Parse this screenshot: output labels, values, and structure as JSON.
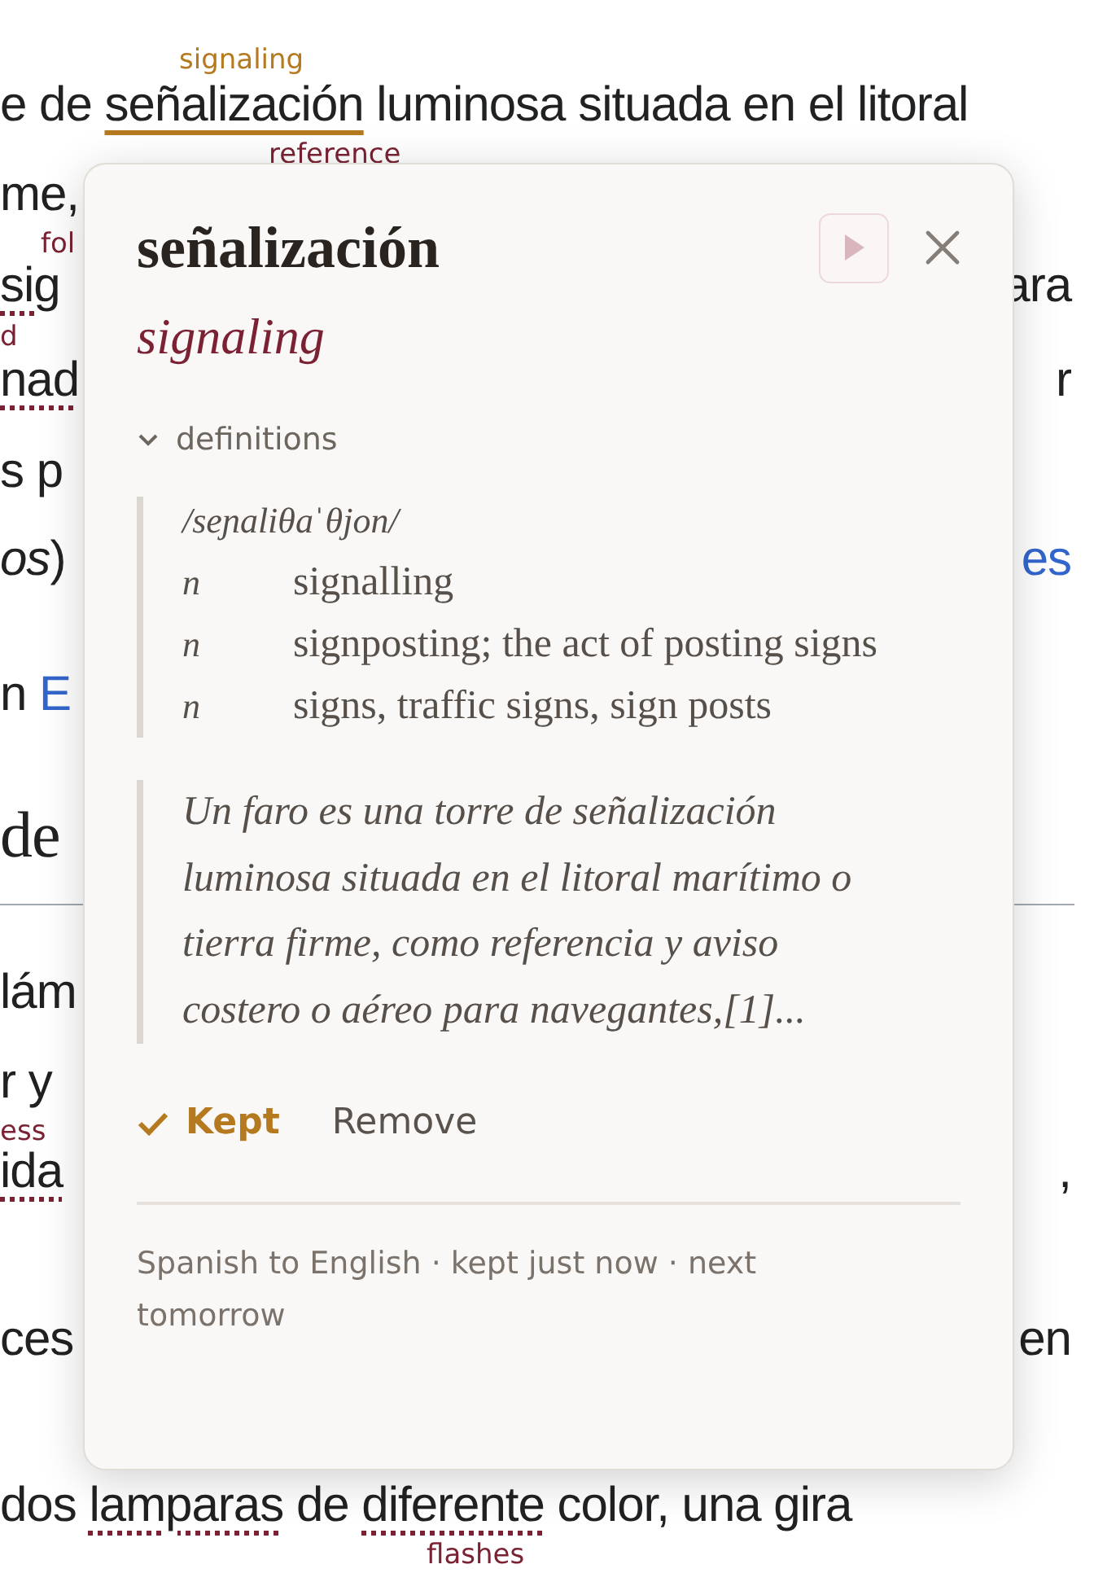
{
  "article": {
    "rows": [
      {
        "kind": "text",
        "left": [
          {
            "text": "e de ",
            "kind": "plain"
          },
          {
            "text": "señalización",
            "kind": "current"
          },
          {
            "text": " luminosa situada en el litoral",
            "kind": "plain"
          }
        ],
        "right": [],
        "glosses": [
          {
            "text": "signaling",
            "color": "#b5791f"
          },
          {
            "text": "reference",
            "color": "#7a2233"
          }
        ]
      },
      {
        "kind": "text",
        "left": [
          {
            "text": "me,",
            "kind": "plain"
          }
        ],
        "right": [],
        "glosses": [
          {
            "text": "fol",
            "color": "#7a2233"
          }
        ]
      },
      {
        "kind": "text",
        "left": [
          {
            "text": "sig",
            "kind": "pending"
          }
        ],
        "right": [
          {
            "text": "ara",
            "kind": "plain"
          }
        ],
        "glosses": [
          {
            "text": "d",
            "color": "#7a2233"
          }
        ]
      },
      {
        "kind": "text",
        "left": [
          {
            "text": "nad",
            "kind": "pending"
          }
        ],
        "right": [
          {
            "text": "r",
            "kind": "plain"
          }
        ],
        "glosses": []
      },
      {
        "kind": "text",
        "left": [
          {
            "text": "s p",
            "kind": "plain"
          }
        ],
        "right": [],
        "glosses": []
      },
      {
        "kind": "text",
        "left": [
          {
            "text": "os",
            "kind": "italic"
          },
          {
            "text": ")",
            "kind": "plain"
          }
        ],
        "right": [
          {
            "text": "es",
            "kind": "link"
          }
        ],
        "glosses": []
      },
      {
        "kind": "text",
        "left": [
          {
            "text": "n ",
            "kind": "plain"
          },
          {
            "text": "E",
            "kind": "link"
          }
        ],
        "right": [],
        "glosses": []
      },
      {
        "kind": "heading",
        "left": [
          {
            "text": "de",
            "kind": "plain"
          }
        ],
        "right": [],
        "glosses": []
      },
      {
        "kind": "text",
        "left": [
          {
            "text": "lám",
            "kind": "plain"
          }
        ],
        "right": [],
        "glosses": []
      },
      {
        "kind": "text",
        "left": [
          {
            "text": "r y",
            "kind": "plain"
          }
        ],
        "right": [],
        "glosses": [
          {
            "text": "ess",
            "color": "#7a2233"
          }
        ]
      },
      {
        "kind": "text",
        "left": [
          {
            "text": "ida",
            "kind": "pending"
          }
        ],
        "right": [
          {
            "text": ",",
            "kind": "plain"
          }
        ],
        "glosses": []
      },
      {
        "kind": "text",
        "left": [
          {
            "text": "ces",
            "kind": "plain"
          }
        ],
        "right": [
          {
            "text": "en",
            "kind": "plain"
          }
        ],
        "glosses": []
      },
      {
        "kind": "text",
        "left": [
          {
            "text": "dos ",
            "kind": "plain"
          },
          {
            "text": "lamparas",
            "kind": "pending"
          },
          {
            "text": " de ",
            "kind": "plain"
          },
          {
            "text": "diferente",
            "kind": "pending"
          },
          {
            "text": " color, una gira",
            "kind": "plain"
          }
        ],
        "right": [],
        "glosses": [
          {
            "text": "flashes",
            "color": "#7a2233"
          }
        ]
      }
    ]
  },
  "popup": {
    "headword": "señalización",
    "translation": "signaling",
    "section": {
      "label": "definitions",
      "expanded": true
    },
    "pronunciation": "/seɲaliθaˈθjon/",
    "senses": [
      {
        "pos": "n",
        "gloss": "signalling"
      },
      {
        "pos": "n",
        "gloss": "signposting; the act of posting signs"
      },
      {
        "pos": "n",
        "gloss": "signs, traffic signs, sign posts"
      }
    ],
    "example": "Un faro es una torre de señalización luminosa situada en el litoral marítimo o tierra firme, como referencia y aviso costero o aéreo para navegantes,[1]...",
    "actions": [
      {
        "label": "Kept",
        "selected": true
      },
      {
        "label": "Remove",
        "selected": false
      }
    ],
    "footer": "Spanish to English · kept just now · next tomorrow"
  }
}
